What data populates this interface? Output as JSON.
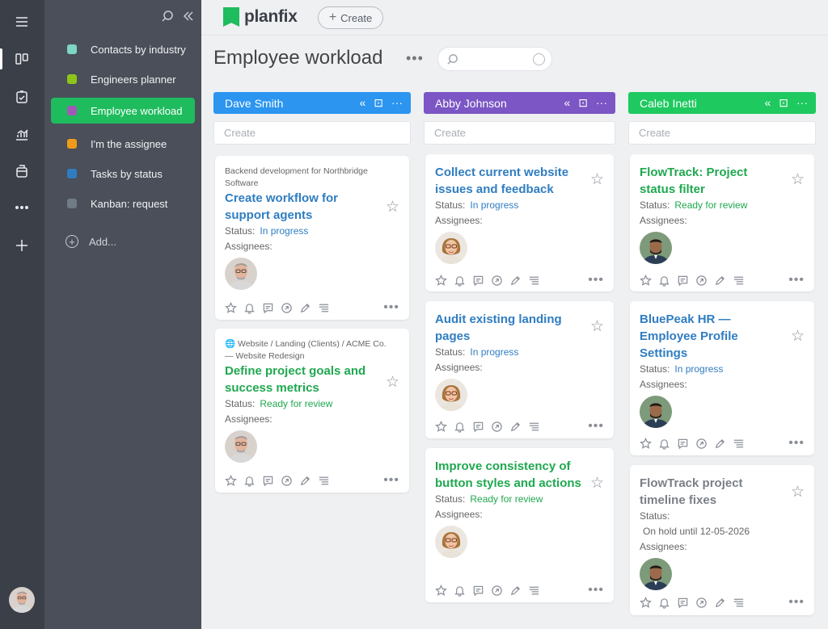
{
  "app": {
    "name": "planfix",
    "create_label": "Create"
  },
  "page": {
    "title": "Employee workload",
    "search_placeholder": ""
  },
  "sidebar": {
    "items": [
      {
        "label": "Contacts by industry",
        "color": "#7ed6c5"
      },
      {
        "label": "Engineers planner",
        "color": "#8ec51b"
      },
      {
        "label": "Employee workload",
        "color": "#a259b6",
        "active": true
      },
      {
        "label": "I'm the assignee",
        "color": "#f29a1a"
      },
      {
        "label": "Tasks by status",
        "color": "#2f7dc1"
      },
      {
        "label": "Kanban: request",
        "color": "#6f7c86"
      }
    ],
    "add_label": "Add..."
  },
  "columns": [
    {
      "name": "Dave Smith",
      "color": "#2b95f0",
      "create_placeholder": "Create",
      "cards": [
        {
          "project": "Backend development for Northbridge Software",
          "title": "Create workflow for support agents",
          "title_color": "blue",
          "status_label": "Status:",
          "status": "In progress",
          "status_color": "blue",
          "assignees_label": "Assignees:"
        },
        {
          "project": "🌐 Website / Landing (Clients) / ACME Co. — Website Redesign",
          "title": "Define project goals and success metrics",
          "title_color": "green",
          "status_label": "Status:",
          "status": "Ready for review",
          "status_color": "green",
          "assignees_label": "Assignees:"
        }
      ]
    },
    {
      "name": "Abby Johnson",
      "color": "#7b56c4",
      "create_placeholder": "Create",
      "cards": [
        {
          "title": "Collect current website issues and feedback",
          "title_color": "blue",
          "status_label": "Status:",
          "status": "In progress",
          "status_color": "blue",
          "assignees_label": "Assignees:"
        },
        {
          "title": "Audit existing landing pages",
          "title_color": "blue",
          "status_label": "Status:",
          "status": "In progress",
          "status_color": "blue",
          "assignees_label": "Assignees:"
        },
        {
          "title": "Improve consistency of button styles and actions",
          "title_color": "green",
          "status_label": "Status:",
          "status": "Ready for review",
          "status_color": "green",
          "assignees_label": "Assignees:"
        }
      ]
    },
    {
      "name": "Caleb Inetti",
      "color": "#1ec95f",
      "create_placeholder": "Create",
      "cards": [
        {
          "title": "FlowTrack: Project status filter",
          "title_color": "green",
          "status_label": "Status:",
          "status": "Ready for review",
          "status_color": "green",
          "assignees_label": "Assignees:"
        },
        {
          "title": "BluePeak HR — Employee Profile Settings",
          "title_color": "blue",
          "status_label": "Status:",
          "status": "In progress",
          "status_color": "blue",
          "assignees_label": "Assignees:"
        },
        {
          "title": "FlowTrack project timeline fixes",
          "title_color": "gray",
          "status_label": "Status:",
          "status": "On hold until 12-05-2026",
          "status_color": "gray",
          "assignees_label": "Assignees:"
        }
      ]
    }
  ]
}
